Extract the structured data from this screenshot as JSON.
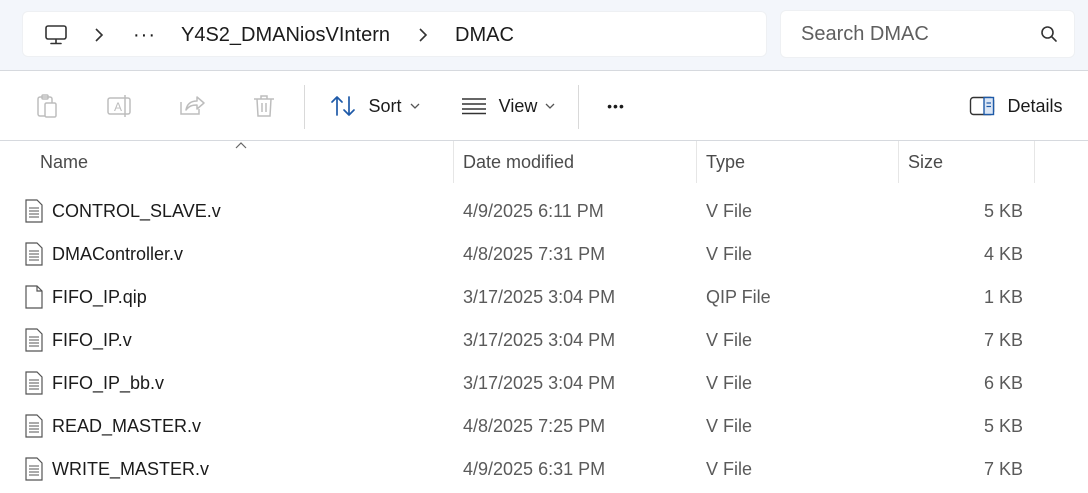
{
  "breadcrumb": {
    "overflow": "···",
    "items": [
      "Y4S2_DMANiosVIntern",
      "DMAC"
    ]
  },
  "search": {
    "placeholder": "Search DMAC"
  },
  "toolbar": {
    "sort_label": "Sort",
    "view_label": "View",
    "more_label": "•••",
    "details_label": "Details"
  },
  "columns": {
    "name": "Name",
    "date": "Date modified",
    "type": "Type",
    "size": "Size"
  },
  "files": [
    {
      "name": "CONTROL_SLAVE.v",
      "date": "4/9/2025 6:11 PM",
      "type": "V File",
      "size": "5 KB",
      "icon": "text-file-icon"
    },
    {
      "name": "DMAController.v",
      "date": "4/8/2025 7:31 PM",
      "type": "V File",
      "size": "4 KB",
      "icon": "text-file-icon"
    },
    {
      "name": "FIFO_IP.qip",
      "date": "3/17/2025 3:04 PM",
      "type": "QIP File",
      "size": "1 KB",
      "icon": "blank-file-icon"
    },
    {
      "name": "FIFO_IP.v",
      "date": "3/17/2025 3:04 PM",
      "type": "V File",
      "size": "7 KB",
      "icon": "text-file-icon"
    },
    {
      "name": "FIFO_IP_bb.v",
      "date": "3/17/2025 3:04 PM",
      "type": "V File",
      "size": "6 KB",
      "icon": "text-file-icon"
    },
    {
      "name": "READ_MASTER.v",
      "date": "4/8/2025 7:25 PM",
      "type": "V File",
      "size": "5 KB",
      "icon": "text-file-icon"
    },
    {
      "name": "WRITE_MASTER.v",
      "date": "4/9/2025 6:31 PM",
      "type": "V File",
      "size": "7 KB",
      "icon": "text-file-icon"
    }
  ]
}
